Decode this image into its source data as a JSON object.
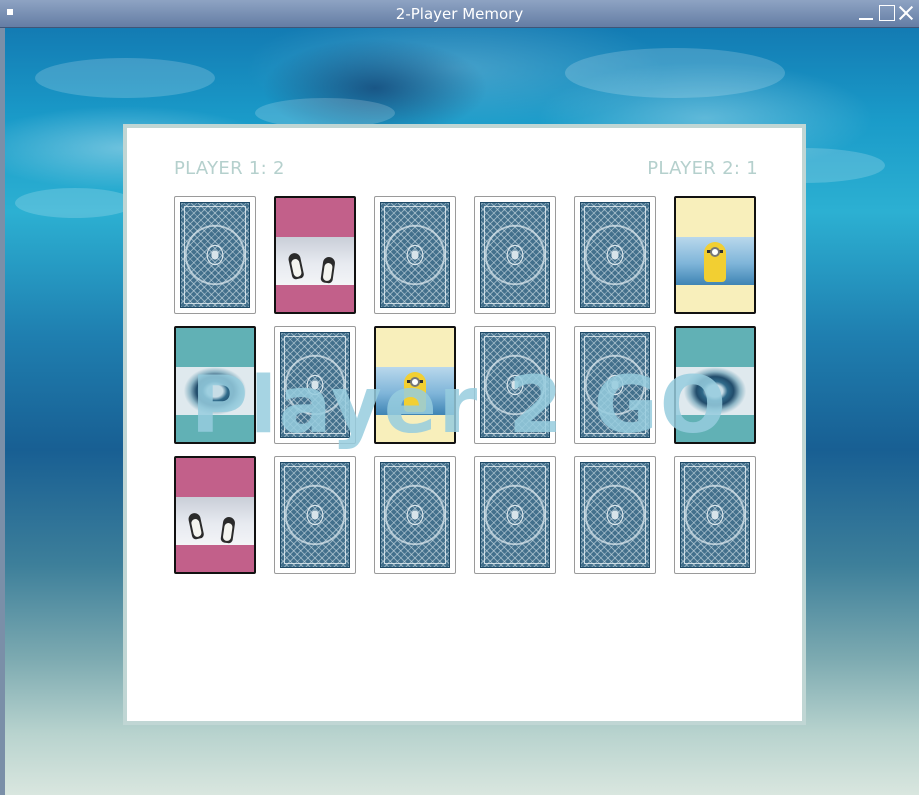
{
  "window": {
    "title": "2-Player Memory"
  },
  "scores": {
    "player1": "PLAYER 1: 2",
    "player2": "PLAYER 2: 1"
  },
  "banner": "Player 2 GO",
  "cards": [
    {
      "state": "back"
    },
    {
      "state": "face",
      "image": "penguins",
      "color": "#c2608a"
    },
    {
      "state": "back"
    },
    {
      "state": "back"
    },
    {
      "state": "back"
    },
    {
      "state": "face",
      "image": "minion",
      "color": "#f8efbb"
    },
    {
      "state": "face",
      "image": "whirl",
      "color": "#61b1b5"
    },
    {
      "state": "back"
    },
    {
      "state": "face",
      "image": "minion",
      "color": "#f8efbb"
    },
    {
      "state": "back"
    },
    {
      "state": "back"
    },
    {
      "state": "face",
      "image": "whirl",
      "color": "#61b1b5"
    },
    {
      "state": "face",
      "image": "penguins",
      "color": "#c2608a"
    },
    {
      "state": "back"
    },
    {
      "state": "back"
    },
    {
      "state": "back"
    },
    {
      "state": "back"
    },
    {
      "state": "back"
    }
  ]
}
